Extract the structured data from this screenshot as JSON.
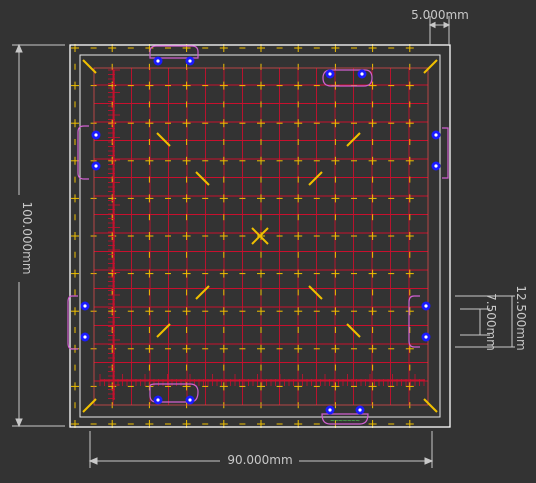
{
  "dimensions": {
    "width_label": "90.000mm",
    "height_label": "100.000mm",
    "margin_label": "5.000mm",
    "offset_label_a": "12.500mm",
    "offset_label_b": "7.500mm"
  },
  "silkscreen": {
    "footer_text": "~~~~~~~"
  },
  "colors": {
    "background": "#333333",
    "outline": "#ffffff",
    "dimension": "#c8c8c8",
    "grid_red": "#c8102e",
    "fiducial_yellow": "#f0c000",
    "pad_blue": "#1a1aff",
    "keepout_magenta": "#d060d0",
    "text_green": "#50c050"
  }
}
